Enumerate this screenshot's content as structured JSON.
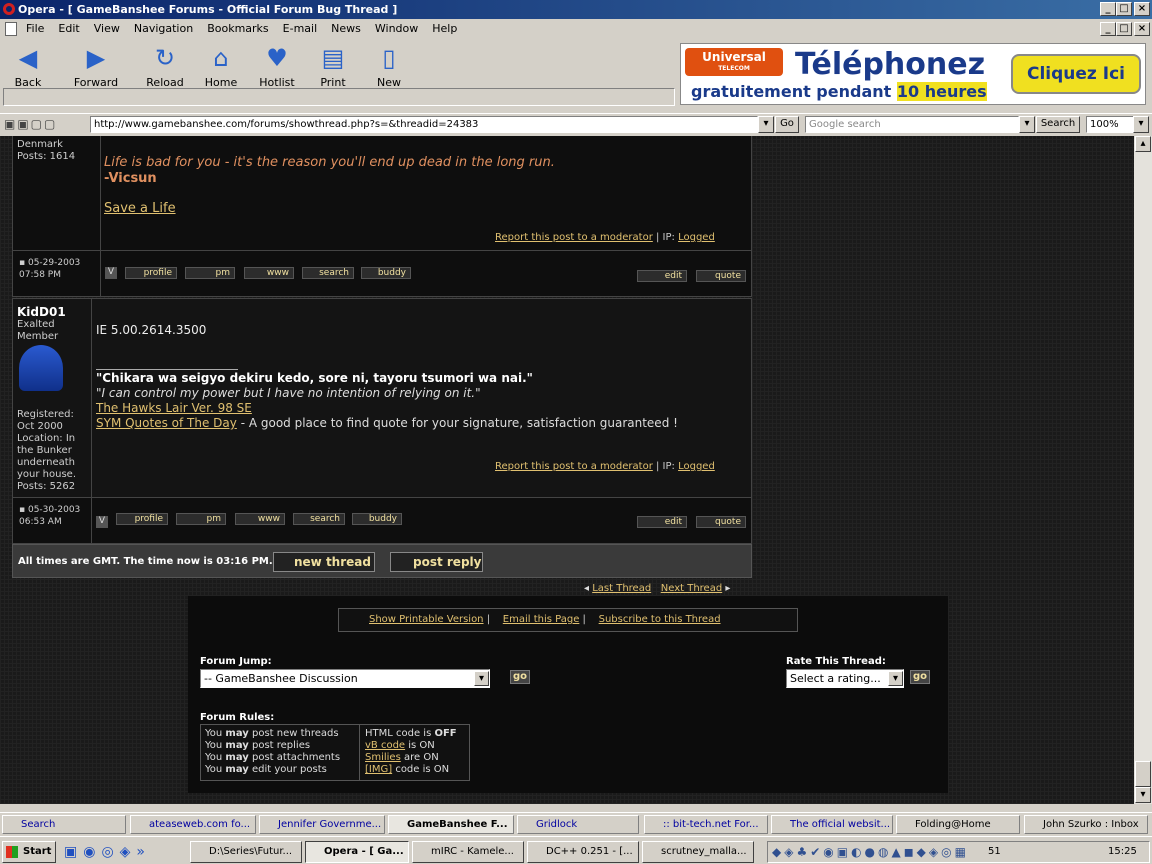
{
  "window": {
    "title": "Opera - [ GameBanshee Forums - Official Forum Bug Thread ]"
  },
  "menu": [
    "File",
    "Edit",
    "View",
    "Navigation",
    "Bookmarks",
    "E-mail",
    "News",
    "Window",
    "Help"
  ],
  "toolbar": [
    {
      "label": "Back",
      "icon": "back-arrow-icon"
    },
    {
      "label": "Forward",
      "icon": "forward-arrow-icon"
    },
    {
      "label": "Reload",
      "icon": "reload-icon"
    },
    {
      "label": "Home",
      "icon": "home-icon"
    },
    {
      "label": "Hotlist",
      "icon": "hotlist-icon"
    },
    {
      "label": "Print",
      "icon": "print-icon"
    },
    {
      "label": "New",
      "icon": "new-page-icon"
    }
  ],
  "ad": {
    "brand": "Universal",
    "brand_sub": "TELECOM",
    "headline": "Téléphonez",
    "sub": "gratuitement pendant",
    "hours": "10 heures",
    "cta": "Cliquez Ici"
  },
  "address": {
    "url": "http://www.gamebanshee.com/forums/showthread.php?s=&threadid=24383",
    "go": "Go",
    "search_placeholder": "Google search",
    "search_button": "Search",
    "zoom": "100%"
  },
  "post1": {
    "location": "Denmark",
    "posts": "Posts: 1614",
    "quote": "Life is bad for you - it's the reason you'll end up dead in the long run.",
    "author": "-Vicsun",
    "link": "Save a Life",
    "report": "Report this post to a moderator",
    "ip": " | IP: ",
    "logged": "Logged",
    "date": "05-29-2003 07:58 PM"
  },
  "post2": {
    "user": "KidD01",
    "title": "Exalted Member",
    "registered": "Registered: Oct 2000",
    "location": "Location: In the Bunker underneath your house.",
    "posts": "Posts: 5262",
    "body": "IE 5.00.2614.3500",
    "sig_jp": "\"Chikara wa seigyo dekiru kedo, sore ni, tayoru tsumori wa nai.\"",
    "sig_en": "\"I can control my power but I have no intention of relying on it.\"",
    "link1": "The Hawks Lair Ver. 98 SE",
    "link2": "SYM Quotes of The Day",
    "link2_tail": " - A good place to find quote for your signature, satisfaction guaranteed !",
    "report": "Report this post to a moderator",
    "ip": " | IP: ",
    "logged": "Logged",
    "date": "05-30-2003 06:53 AM"
  },
  "post_buttons": [
    "profile",
    "pm",
    "www",
    "search",
    "buddy"
  ],
  "edit": "edit",
  "quote": "quote",
  "footer": {
    "times": "All times are GMT. The time now is 03:16 PM.",
    "new_thread": "new thread",
    "post_reply": "post reply",
    "last": "Last Thread",
    "next": "Next Thread"
  },
  "tools": {
    "printable": "Show Printable Version",
    "email": "Email this Page",
    "subscribe": "Subscribe to this Thread"
  },
  "jump": {
    "label": "Forum Jump:",
    "value": "-- GameBanshee Discussion",
    "go": "go"
  },
  "rate": {
    "label": "Rate This Thread:",
    "value": "Select a rating...",
    "go": "go"
  },
  "rules": {
    "label": "Forum Rules:",
    "left": [
      [
        "You ",
        "may",
        " post new threads"
      ],
      [
        "You ",
        "may",
        " post replies"
      ],
      [
        "You ",
        "may",
        " post attachments"
      ],
      [
        "You ",
        "may",
        " edit your posts"
      ]
    ],
    "right": [
      [
        "HTML code is ",
        "",
        "OFF"
      ],
      [
        "",
        "vB code",
        " is ON"
      ],
      [
        "",
        "Smilies",
        " are ON"
      ],
      [
        "",
        "[IMG]",
        " code is ON"
      ]
    ]
  },
  "tabs": [
    "Search",
    "ateaseweb.com fo...",
    "Jennifer Governme...",
    "GameBanshee F...",
    "Gridlock",
    ":: bit-tech.net For...",
    "The official websit...",
    "Folding@Home",
    "John Szurko : Inbox"
  ],
  "taskbar": {
    "start": "Start",
    "items": [
      "D:\\Series\\Futur...",
      "Opera - [ Ga...",
      "mIRC - Kamele...",
      "DC++ 0.251 - [...",
      "scrutney_malla..."
    ],
    "clock": "15:25",
    "tray_num": "51"
  }
}
